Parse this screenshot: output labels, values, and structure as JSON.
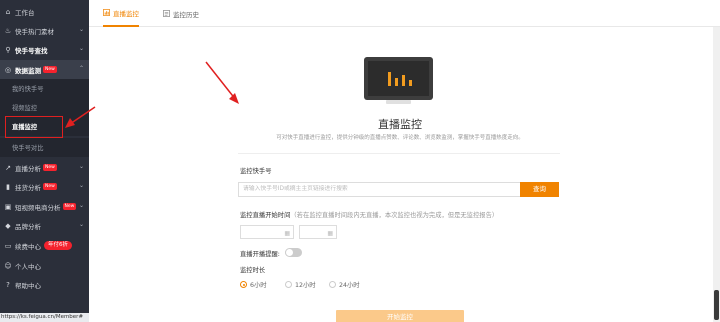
{
  "sidebar": {
    "items": [
      {
        "label": "工作台",
        "icon": "home-icon"
      },
      {
        "label": "快手热门素材",
        "icon": "fire-icon"
      },
      {
        "label": "快手号查找",
        "icon": "search-icon"
      },
      {
        "label": "数据监测",
        "icon": "monitor-icon",
        "badge": "New"
      },
      {
        "label": "直播分析",
        "icon": "chart-icon",
        "badge": "New"
      },
      {
        "label": "挂货分析",
        "icon": "bar-icon",
        "badge": "New"
      },
      {
        "label": "短视频电商分析",
        "icon": "video-icon",
        "badge": "New"
      },
      {
        "label": "品牌分析",
        "icon": "diamond-icon"
      },
      {
        "label": "续费中心",
        "icon": "card-icon",
        "pill": "年付6折"
      },
      {
        "label": "个人中心",
        "icon": "user-icon"
      },
      {
        "label": "帮助中心",
        "icon": "help-icon"
      }
    ],
    "sub_items": [
      "我的快手号",
      "视频监控",
      "直播监控",
      "快手号对比"
    ],
    "status_url": "https://ks.feigua.cn/Member#"
  },
  "tabs": [
    {
      "label": "直播监控",
      "icon": "bar-chart-icon",
      "active": true
    },
    {
      "label": "监控历史",
      "icon": "list-icon",
      "active": false
    }
  ],
  "hero": {
    "title": "直播监控",
    "subtitle": "可对快手直播进行监控，提供分钟级的直播点赞数、评论数、浏览数监测，掌握快手号直播热度走向。"
  },
  "form": {
    "account_label": "监控快手号",
    "account_placeholder": "请输入快手号ID或摘主主页链接进行搜索",
    "query_button": "查询",
    "start_time_label": "监控直播开始时间",
    "start_time_hint": "（若在监控直播时间段内无直播，本次监控也视为完成，但是无监控报告）",
    "reminder_label": "直播开播提醒:",
    "duration_label": "监控时长",
    "durations": [
      "6小时",
      "12小时",
      "24小时"
    ],
    "selected_duration": "6小时",
    "start_button": "开始监控"
  },
  "colors": {
    "accent": "#f08300",
    "sidebar_bg": "#2b2f3a",
    "badge": "#f5222d",
    "annotation": "#e02020"
  }
}
